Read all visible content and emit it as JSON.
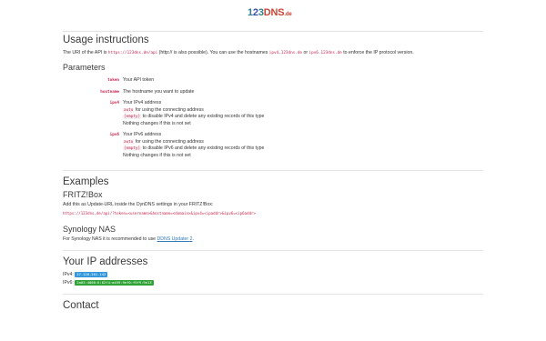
{
  "logo": {
    "part1": "1",
    "part2": "2",
    "part3": "3",
    "dns": "DNS",
    "tld": ".de"
  },
  "usage": {
    "title": "Usage instructions",
    "uri_prefix": "The URI of the API is",
    "uri_code": "https://123dns.de/api",
    "uri_mid": "(http:// is also possible). You can use the hostnames",
    "host4": "ipv4.123dns.de",
    "or": "or",
    "host6": "ipv6.123dns.de",
    "uri_suffix": "to enforce the IP protocol version."
  },
  "params": {
    "title": "Parameters",
    "token_key": "token",
    "token_desc": "Your API token",
    "hostname_key": "hostname",
    "hostname_desc": "The hostname you want to update",
    "ipv4_key": "ipv4",
    "ipv4_desc": "Your IPv4 address",
    "ipv4_auto": "auto",
    "ipv4_auto_desc": "for using the connecting address",
    "ipv4_empty": "[empty]",
    "ipv4_empty_desc": "to disable IPv4 and delete any existing records of this type",
    "ipv4_nothing": "Nothing changes if this is not set",
    "ipv6_key": "ipv6",
    "ipv6_desc": "Your IPv6 address",
    "ipv6_auto": "auto",
    "ipv6_auto_desc": "for using the connecting address",
    "ipv6_empty": "[empty]",
    "ipv6_empty_desc": "to disable IPv6 and delete any existing records of this type",
    "ipv6_nothing": "Nothing changes if this is not set"
  },
  "examples": {
    "title": "Examples",
    "fritz_title": "FRITZ!Box",
    "fritz_text": "Add this as Update-URL inside the DynDNS settings in your FRITZ!Box:",
    "fritz_url": "https://123dns.de/api/?token=<username>&hostname=<domain>&ipv4=<ipaddr>&ipv6=<ip6addr>",
    "synology_title": "Synology NAS",
    "synology_text": "For Synology NAS it is recommended to use",
    "synology_link": "DDNS Updater 2",
    "synology_end": "."
  },
  "ip": {
    "title": "Your IP addresses",
    "ipv4_label": "IPv4:",
    "ipv4_value": "37.120.201.142",
    "ipv6_label": "IPv6:",
    "ipv6_value": "2a03:4000:6:62f4:a459:9ef0:f9f9:9e13"
  },
  "contact": {
    "title": "Contact"
  }
}
